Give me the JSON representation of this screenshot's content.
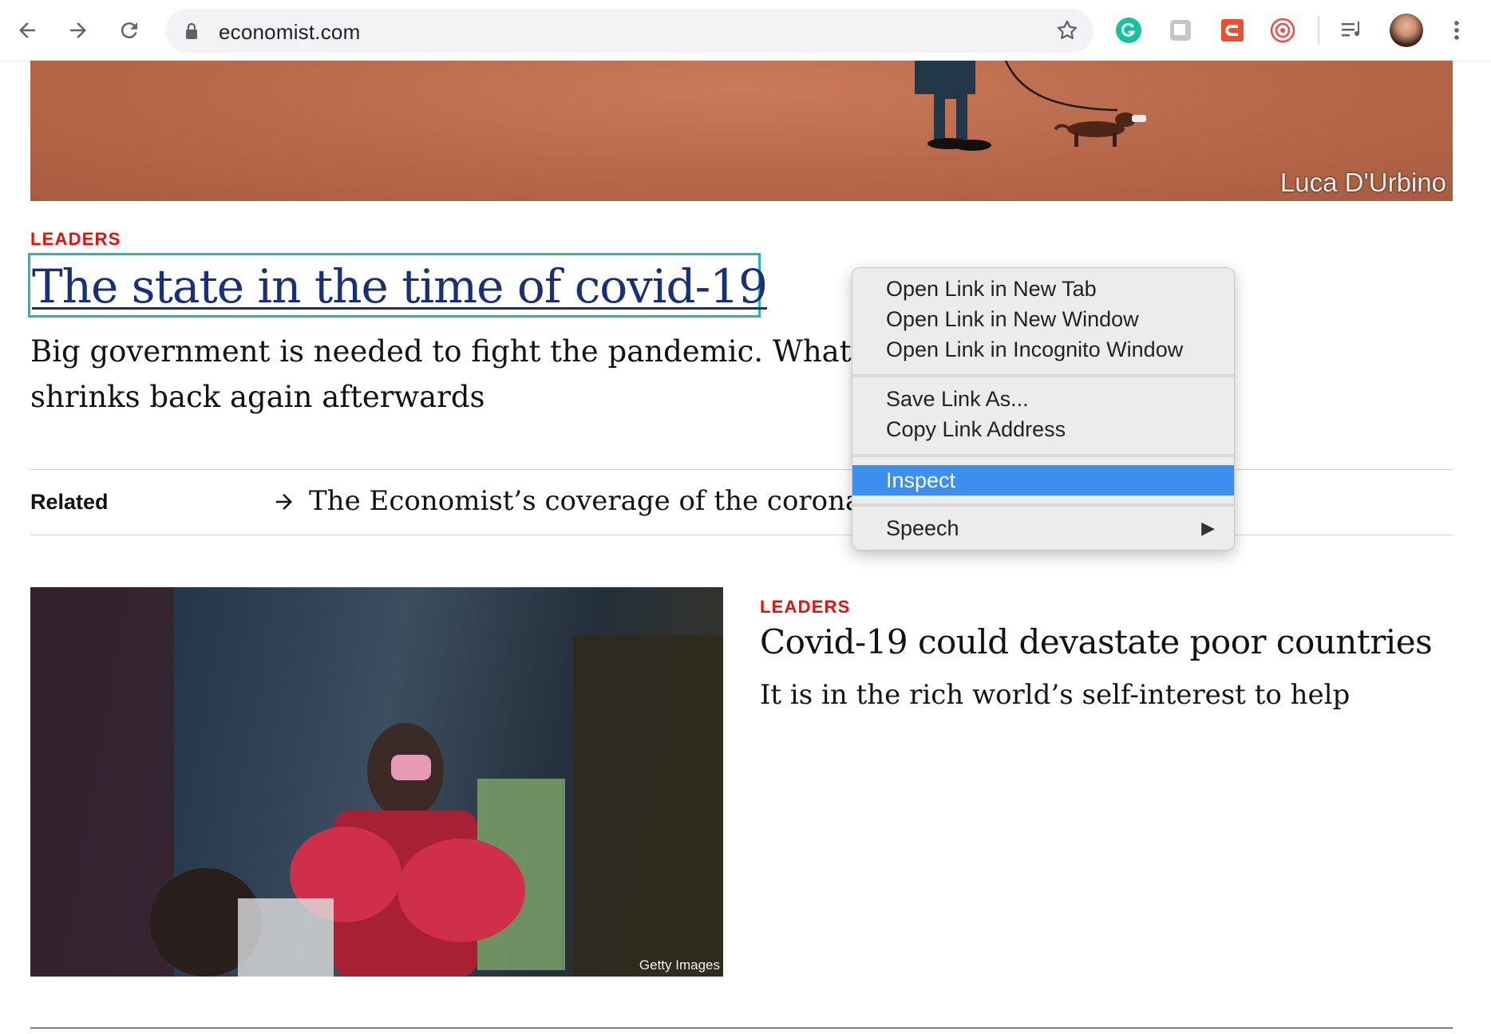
{
  "browser": {
    "url": "economist.com",
    "buttons": {
      "back": "back-icon",
      "forward": "forward-icon",
      "reload": "reload-icon",
      "bookmark": "star-icon",
      "menu": "more-vert-icon"
    },
    "extensions": [
      "grammarly-icon",
      "notion-icon",
      "todoist-icon",
      "spiral-icon",
      "media-control-icon",
      "profile-avatar"
    ]
  },
  "hero": {
    "credit": "Luca D'Urbino"
  },
  "lead_article": {
    "section": "LEADERS",
    "title": "The state in the time of covid-19",
    "summary_line1": "Big government is needed to fight the pandemic. What matters is how it",
    "summary_line2": "shrinks back again afterwards"
  },
  "related": {
    "label": "Related",
    "link": "The Economist’s coverage of the coronavirus"
  },
  "second_article": {
    "section": "LEADERS",
    "title": "Covid-19 could devastate poor countries",
    "summary": "It is in the rich world’s self-interest to help",
    "image_credit": "Getty Images"
  },
  "context_menu": {
    "open_new_tab": "Open Link in New Tab",
    "open_new_window": "Open Link in New Window",
    "open_incognito": "Open Link in Incognito Window",
    "save_link": "Save Link As...",
    "copy_link": "Copy Link Address",
    "inspect": "Inspect",
    "speech": "Speech",
    "highlighted": "Inspect"
  },
  "colors": {
    "accent_red": "#e3120b",
    "link_blue": "#1a2f7a",
    "focus_ring": "#23b8b0",
    "menu_highlight": "#3d8fef"
  }
}
